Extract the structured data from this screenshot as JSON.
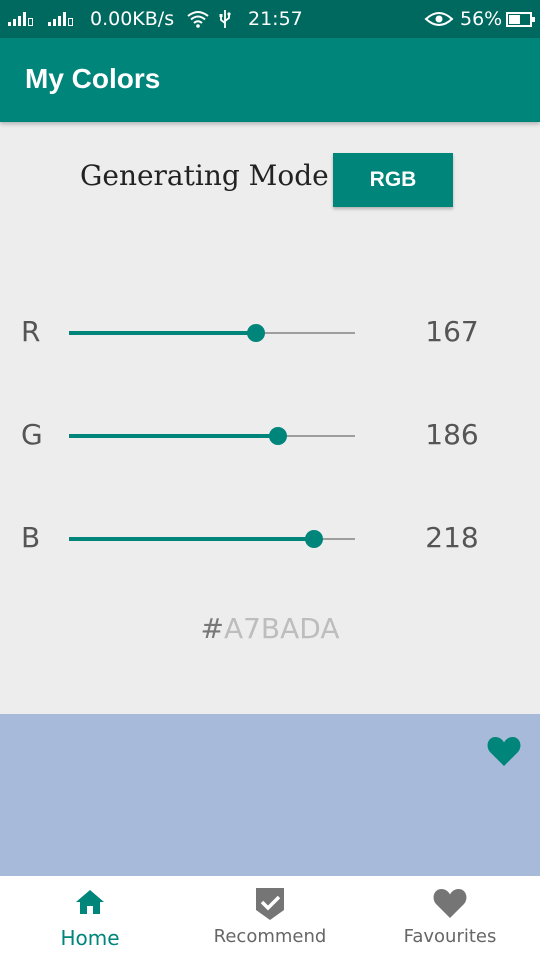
{
  "status_bar": {
    "network_speed": "0.00KB/s",
    "time": "21:57",
    "battery": "56%",
    "battery_level": 0.56,
    "icons": [
      "signal-icon",
      "signal-icon",
      "wifi-icon",
      "usb-icon",
      "eye-icon",
      "battery-icon"
    ]
  },
  "app_bar": {
    "title": "My Colors"
  },
  "mode": {
    "label": "Generating Mode",
    "button": "RGB"
  },
  "channels": [
    {
      "label": "R",
      "value": "167",
      "level": 167
    },
    {
      "label": "G",
      "value": "186",
      "level": 186
    },
    {
      "label": "B",
      "value": "218",
      "level": 218
    }
  ],
  "slider_max": 255,
  "hex": {
    "hash": "#",
    "value": "A7BADA"
  },
  "preview": {
    "color": "#a7bada",
    "favorite_icon": "heart-icon"
  },
  "colors": {
    "primary": "#00857a",
    "primary_dark": "#00695f"
  },
  "bottom_nav": {
    "home": {
      "label": "Home",
      "icon": "home-icon"
    },
    "recommend": {
      "label": "Recommend",
      "icon": "shield-check-icon"
    },
    "favourites": {
      "label": "Favourites",
      "icon": "heart-icon"
    }
  }
}
